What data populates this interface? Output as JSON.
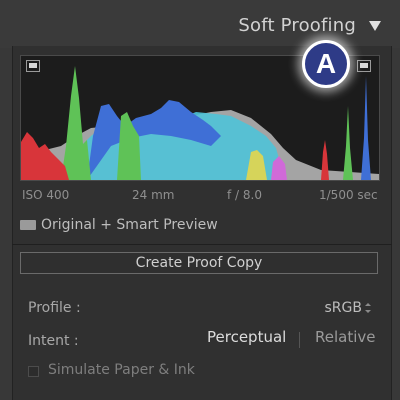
{
  "panel": {
    "title": "Soft Proofing",
    "collapse_icon": "triangle-down-icon"
  },
  "histogram": {
    "exif": {
      "iso": "ISO 400",
      "focal_length": "24 mm",
      "aperture": "f / 8.0",
      "shutter": "1/500 sec"
    },
    "shadow_clip_icon": "clipping-indicator-icon",
    "highlight_clip_icon": "clipping-indicator-icon"
  },
  "badge": {
    "letter": "A",
    "color": "#2e3b87"
  },
  "preview": {
    "icon": "photo-preview-icon",
    "label": "Original + Smart Preview"
  },
  "proof_button": {
    "label": "Create Proof Copy"
  },
  "profile": {
    "label": "Profile :",
    "value": "sRGB",
    "icon": "up-down-arrows-icon"
  },
  "intent": {
    "label": "Intent :",
    "options": [
      "Perceptual",
      "Relative"
    ],
    "selected": "Perceptual"
  },
  "simulate": {
    "label": "Simulate Paper & Ink",
    "checked": false
  },
  "colors": {
    "red": "#d8353a",
    "green": "#5fc257",
    "blue": "#3f6fd6",
    "cyan": "#4fc3d8",
    "gray": "#a4a4a4",
    "yellow": "#d6d45a"
  }
}
